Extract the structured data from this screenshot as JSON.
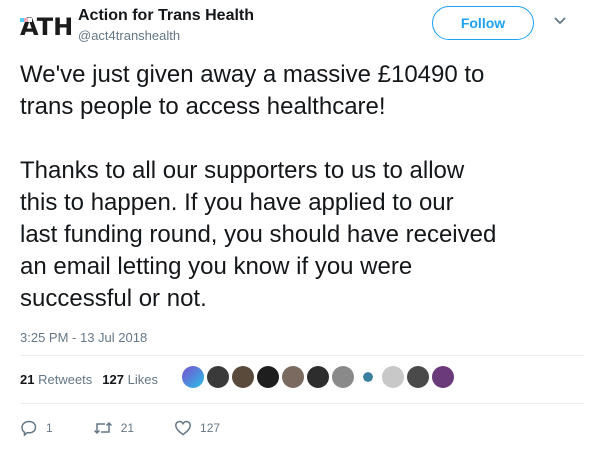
{
  "account": {
    "logo_text": "ATH",
    "name": "Action for Trans Health",
    "handle": "@act4transhealth",
    "follow_label": "Follow"
  },
  "tweet": {
    "text": "We've just given away a massive £10490 to\ntrans people to access healthcare!\n\nThanks to all our supporters to us to allow\nthis to happen. If you have applied to our\nlast funding round, you should have received\nan email letting you know if you were\nsuccessful or not.",
    "timestamp": "3:25 PM - 13 Jul 2018"
  },
  "stats": {
    "retweets_count": "21",
    "retweets_label": "Retweets",
    "likes_count": "127",
    "likes_label": "Likes"
  },
  "actions": {
    "reply_count": "1",
    "retweet_count": "21",
    "like_count": "127"
  },
  "colors": {
    "accent": "#1da1f2",
    "muted": "#657786",
    "text": "#14171a"
  }
}
